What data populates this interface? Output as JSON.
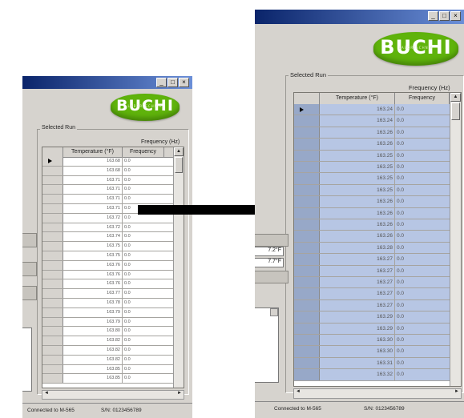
{
  "window_buttons": [
    "_",
    "□",
    "×"
  ],
  "logo": {
    "text": "BUCHI",
    "subtitle": "LABORTECHNIK"
  },
  "group_label": "Selected Run",
  "frequency_label": "Frequency (Hz)",
  "columns": {
    "temperature": "Temperature (°F)",
    "frequency": "Frequency"
  },
  "small_table_rows": [
    {
      "t": "163.68",
      "f": "0.0"
    },
    {
      "t": "163.68",
      "f": "0.0"
    },
    {
      "t": "163.71",
      "f": "0.0"
    },
    {
      "t": "163.71",
      "f": "0.0"
    },
    {
      "t": "163.71",
      "f": "0.0"
    },
    {
      "t": "163.71",
      "f": "0.0"
    },
    {
      "t": "163.72",
      "f": "0.0"
    },
    {
      "t": "163.72",
      "f": "0.0"
    },
    {
      "t": "163.74",
      "f": "0.0"
    },
    {
      "t": "163.75",
      "f": "0.0"
    },
    {
      "t": "163.75",
      "f": "0.0"
    },
    {
      "t": "163.76",
      "f": "0.0"
    },
    {
      "t": "163.76",
      "f": "0.0"
    },
    {
      "t": "163.76",
      "f": "0.0"
    },
    {
      "t": "163.77",
      "f": "0.0"
    },
    {
      "t": "163.78",
      "f": "0.0"
    },
    {
      "t": "163.79",
      "f": "0.0"
    },
    {
      "t": "163.79",
      "f": "0.0"
    },
    {
      "t": "163.80",
      "f": "0.0"
    },
    {
      "t": "163.82",
      "f": "0.0"
    },
    {
      "t": "163.82",
      "f": "0.0"
    },
    {
      "t": "163.82",
      "f": "0.0"
    },
    {
      "t": "163.85",
      "f": "0.0"
    },
    {
      "t": "163.85",
      "f": "0.0"
    }
  ],
  "large_table_rows": [
    {
      "t": "163.24",
      "f": "0.0"
    },
    {
      "t": "163.24",
      "f": "0.0"
    },
    {
      "t": "163.26",
      "f": "0.0"
    },
    {
      "t": "163.26",
      "f": "0.0"
    },
    {
      "t": "163.25",
      "f": "0.0"
    },
    {
      "t": "163.25",
      "f": "0.0"
    },
    {
      "t": "163.25",
      "f": "0.0"
    },
    {
      "t": "163.25",
      "f": "0.0"
    },
    {
      "t": "163.26",
      "f": "0.0"
    },
    {
      "t": "163.26",
      "f": "0.0"
    },
    {
      "t": "163.26",
      "f": "0.0"
    },
    {
      "t": "163.26",
      "f": "0.0"
    },
    {
      "t": "163.28",
      "f": "0.0"
    },
    {
      "t": "163.27",
      "f": "0.0"
    },
    {
      "t": "163.27",
      "f": "0.0"
    },
    {
      "t": "163.27",
      "f": "0.0"
    },
    {
      "t": "163.27",
      "f": "0.0"
    },
    {
      "t": "163.27",
      "f": "0.0"
    },
    {
      "t": "163.29",
      "f": "0.0"
    },
    {
      "t": "163.29",
      "f": "0.0"
    },
    {
      "t": "163.30",
      "f": "0.0"
    },
    {
      "t": "163.30",
      "f": "0.0"
    },
    {
      "t": "163.31",
      "f": "0.0"
    },
    {
      "t": "163.32",
      "f": "0.0"
    }
  ],
  "side_values": [
    "7.2°F",
    "7.7°F"
  ],
  "status_left": {
    "connection": "Connected to M-565",
    "serial": "S/N: 0123456789"
  },
  "status_right": {
    "connection": "Connected to M-565",
    "serial": "S/N: 0123456789"
  },
  "colors": {
    "selection": "#b7c6e4",
    "logo_green": "#5fb30b",
    "titlebar": "#0a246a"
  }
}
